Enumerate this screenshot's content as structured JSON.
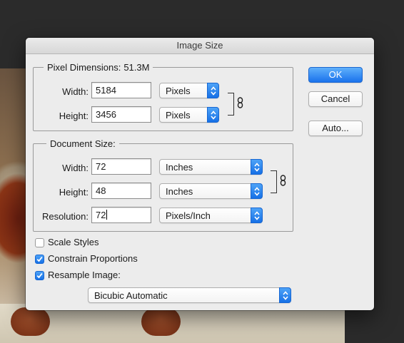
{
  "dialog": {
    "title": "Image Size"
  },
  "pixel_dimensions": {
    "legend": "Pixel Dimensions:",
    "size": "51.3M",
    "width_label": "Width:",
    "width_value": "5184",
    "width_unit": "Pixels",
    "height_label": "Height:",
    "height_value": "3456",
    "height_unit": "Pixels"
  },
  "document_size": {
    "legend": "Document Size:",
    "width_label": "Width:",
    "width_value": "72",
    "width_unit": "Inches",
    "height_label": "Height:",
    "height_value": "48",
    "height_unit": "Inches",
    "resolution_label": "Resolution:",
    "resolution_value": "72",
    "resolution_unit": "Pixels/Inch"
  },
  "buttons": {
    "ok": "OK",
    "cancel": "Cancel",
    "auto": "Auto..."
  },
  "options": {
    "scale_styles": {
      "label": "Scale Styles",
      "checked": false
    },
    "constrain_proportions": {
      "label": "Constrain Proportions",
      "checked": true
    },
    "resample_image": {
      "label": "Resample Image:",
      "checked": true
    }
  },
  "resample_method": "Bicubic Automatic",
  "icons": {
    "link": "chain-link-icon",
    "popup": "updown-arrows-icon",
    "check": "checkmark-icon"
  },
  "colors": {
    "accent": "#1670e6",
    "dialog_bg": "#ececec",
    "backdrop": "#2b2b2b"
  }
}
